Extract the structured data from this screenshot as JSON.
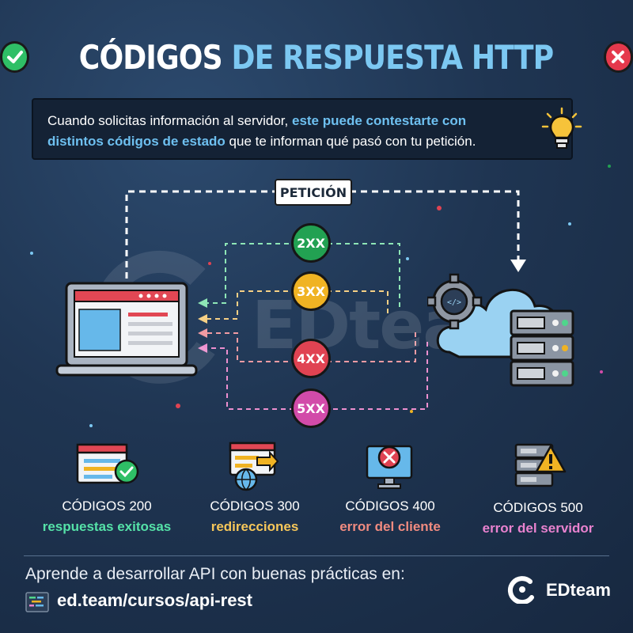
{
  "title": {
    "part1": "CÓDIGOS",
    "part2": "DE RESPUESTA HTTP"
  },
  "intro": {
    "seg1": "Cuando solicitas información al servidor, ",
    "seg2": "este puede contestarte con distintos códigos de estado",
    "seg3": " que te informan qué pasó con tu petición."
  },
  "diagram": {
    "request_label": "PETICIÓN",
    "watermark": "EDteam",
    "codes": [
      {
        "label": "2XX",
        "color": "#22a152"
      },
      {
        "label": "3XX",
        "color": "#f0b323"
      },
      {
        "label": "4XX",
        "color": "#e04352"
      },
      {
        "label": "5XX",
        "color": "#d24ba9"
      }
    ]
  },
  "categories": [
    {
      "title": "CÓDIGOS 200",
      "subtitle": "respuestas exitosas",
      "color": "#55e2a8",
      "icon": "browser-check-icon"
    },
    {
      "title": "CÓDIGOS 300",
      "subtitle": "redirecciones",
      "color": "#f6c75a",
      "icon": "browser-globe-icon"
    },
    {
      "title": "CÓDIGOS 400",
      "subtitle": "error del cliente",
      "color": "#f08b80",
      "icon": "monitor-error-icon"
    },
    {
      "title": "CÓDIGOS 500",
      "subtitle": "error del servidor",
      "color": "#e982cf",
      "icon": "server-warning-icon"
    }
  ],
  "footer": {
    "learn_text": "Aprende a desarrollar API con buenas prácticas en:",
    "url": "ed.team/cursos/api-rest",
    "brand": "EDteam"
  }
}
